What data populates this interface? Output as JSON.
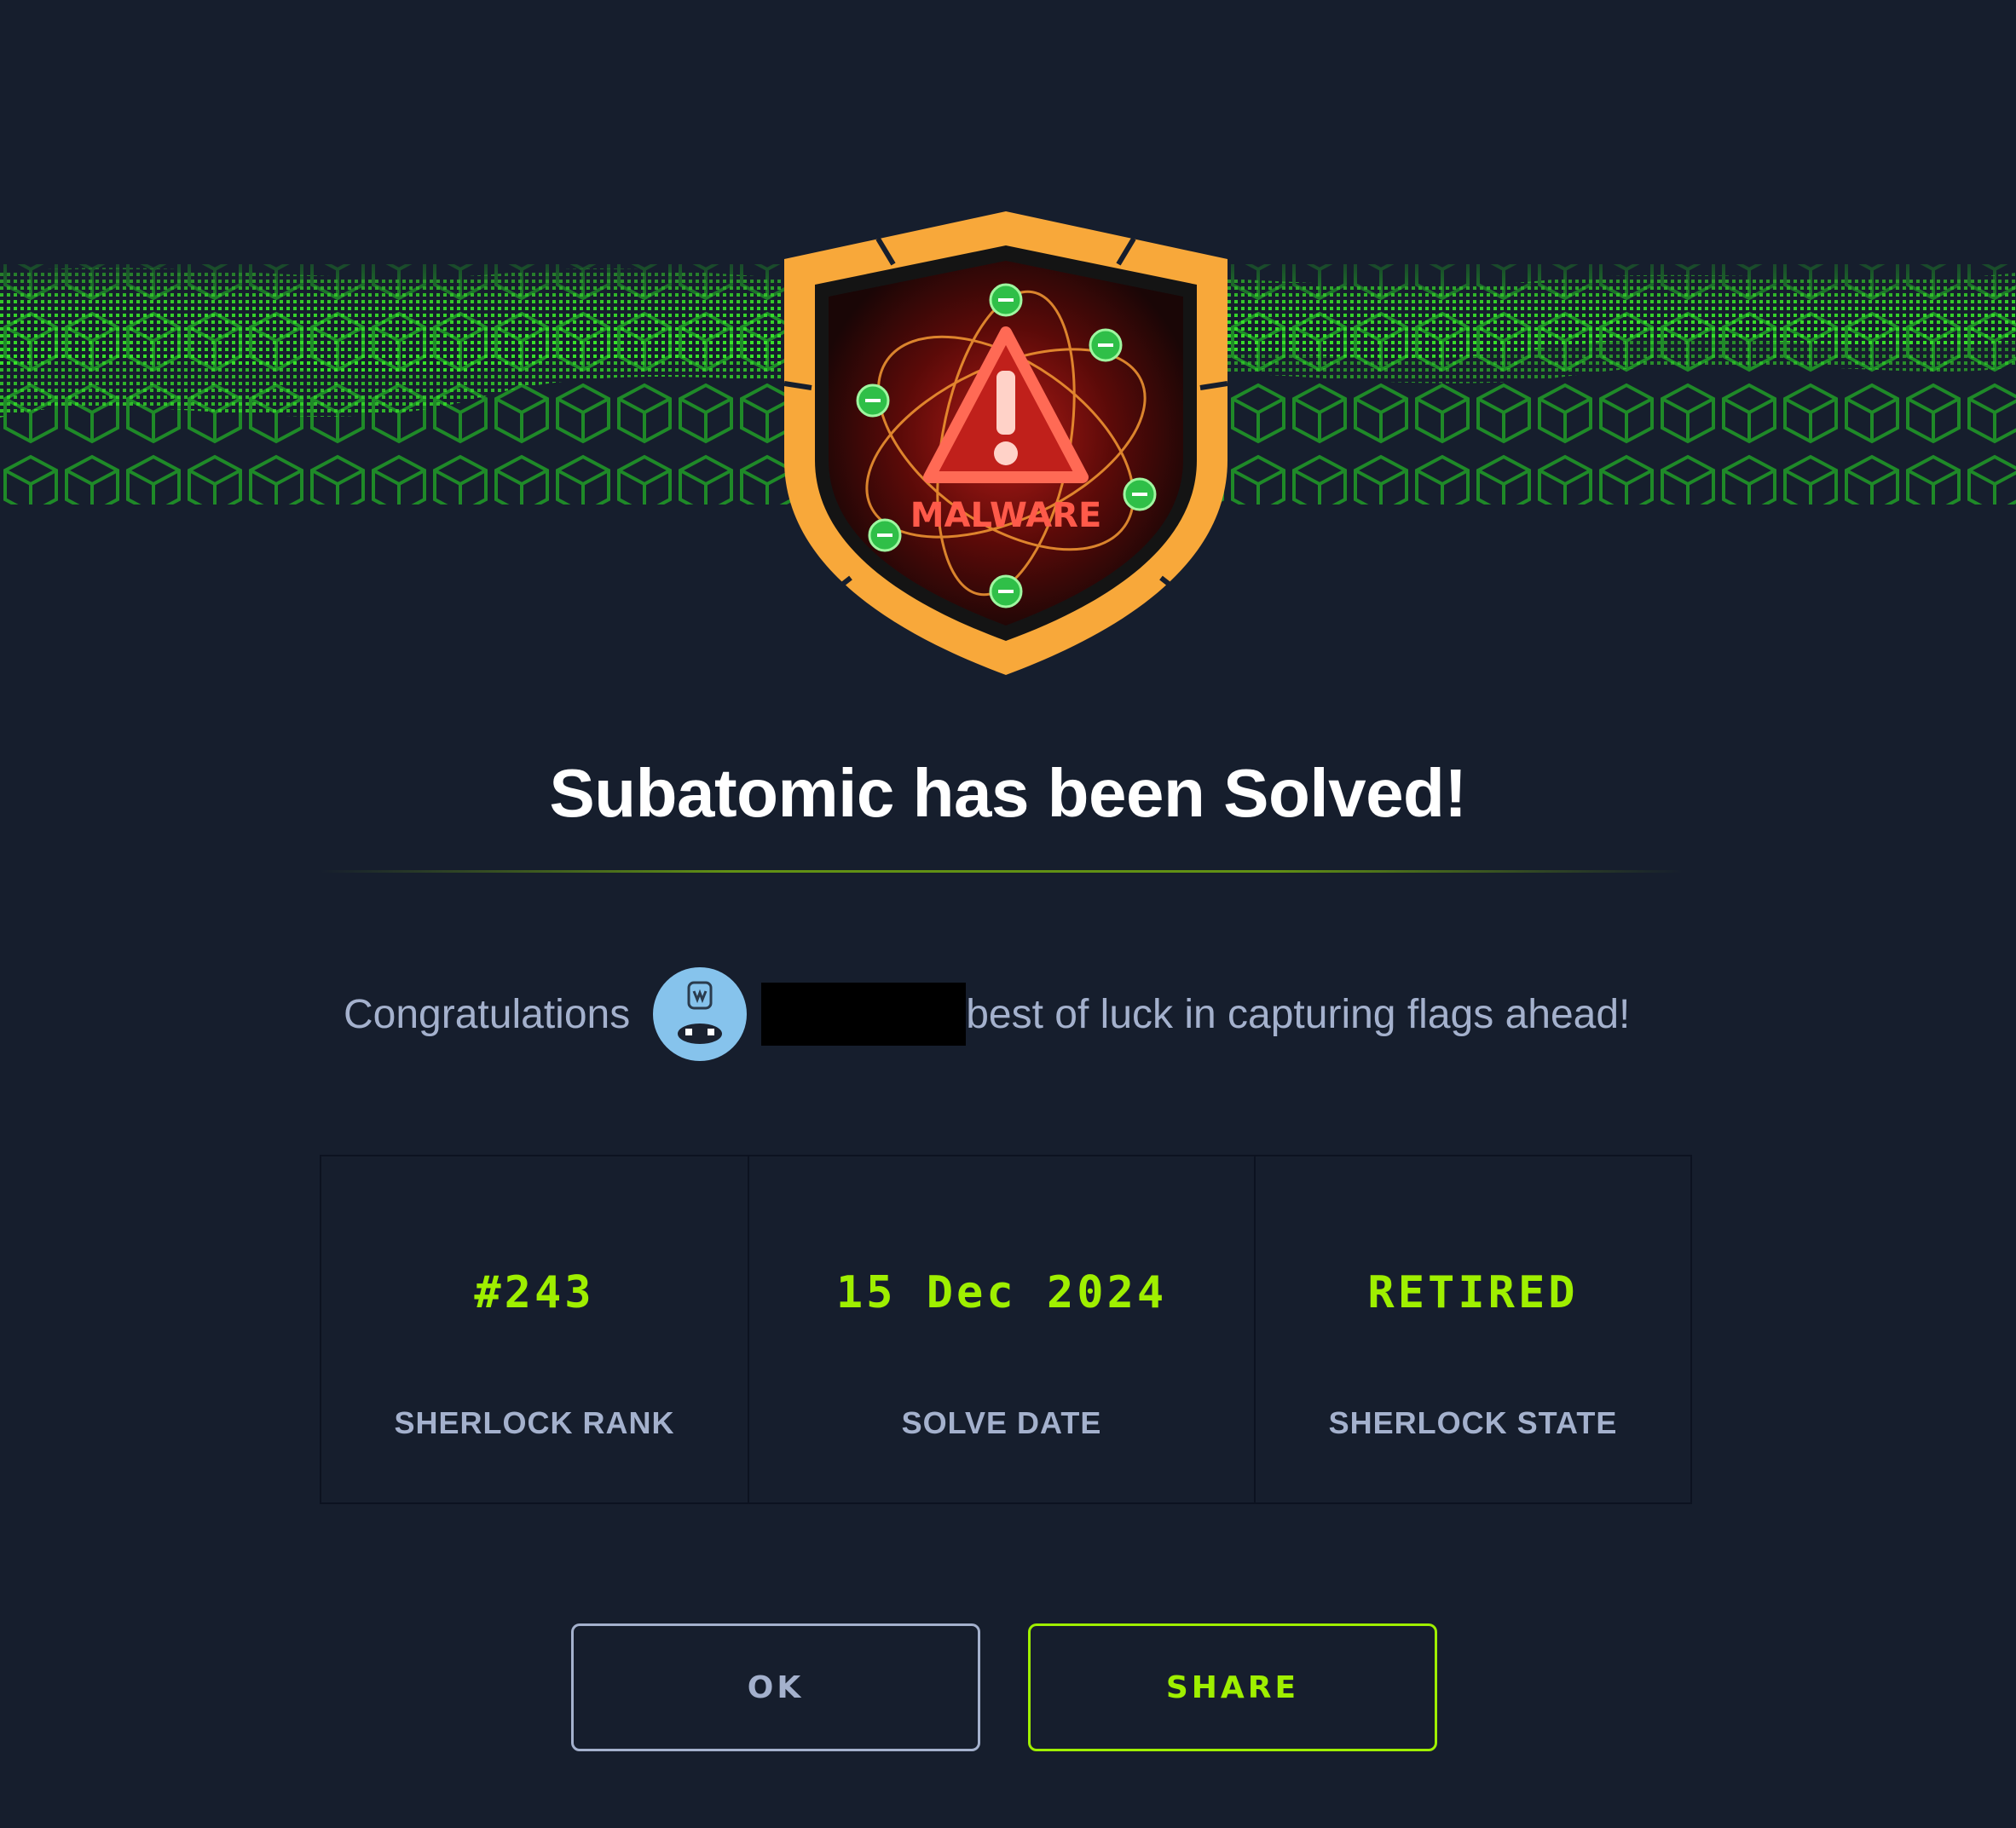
{
  "badge": {
    "label": "MALWARE",
    "icon": "malware-warning-shield"
  },
  "title": "Subatomic has been Solved!",
  "congrats": {
    "prefix": "Congratulations",
    "suffix": "best of luck in capturing flags ahead!",
    "avatar_icon": "user-avatar"
  },
  "stats": [
    {
      "value": "#243",
      "label": "SHERLOCK RANK"
    },
    {
      "value": "15 Dec 2024",
      "label": "SOLVE DATE"
    },
    {
      "value": "RETIRED",
      "label": "SHERLOCK STATE"
    }
  ],
  "buttons": {
    "ok": "OK",
    "share": "SHARE"
  },
  "colors": {
    "background": "#161e2d",
    "accent_green": "#9fef00",
    "muted_text": "#a4b1cd",
    "badge_orange": "#f8a83a",
    "badge_red": "#e5413b"
  }
}
